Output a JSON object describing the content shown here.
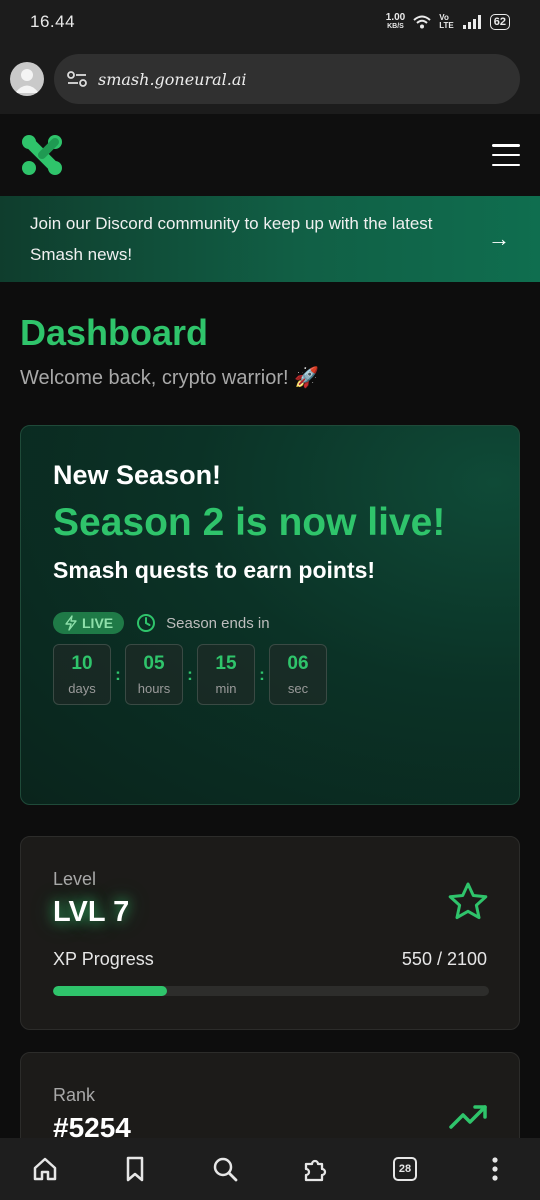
{
  "status_bar": {
    "time": "16.44",
    "net_speed": "1.00",
    "net_unit": "KB/S",
    "volte_top": "Vo",
    "volte_bottom": "LTE",
    "battery": "62"
  },
  "browser": {
    "url": "smash.goneural.ai",
    "icons": [
      "account-avatar-icon",
      "site-settings-icon"
    ]
  },
  "header": {
    "logo_icon": "smash-logo-icon",
    "menu_icon": "hamburger-menu-icon"
  },
  "banner": {
    "text": "Join our Discord community to keep up with the latest Smash news!",
    "arrow": "→"
  },
  "dashboard": {
    "title": "Dashboard",
    "subtitle": "Welcome back, crypto warrior! 🚀"
  },
  "season": {
    "kicker": "New Season!",
    "headline": "Season 2 is now live!",
    "subline": "Smash quests to earn points!",
    "badge": "LIVE",
    "ends_label": "Season ends in",
    "countdown": [
      {
        "value": "10",
        "unit": "days"
      },
      {
        "value": "05",
        "unit": "hours"
      },
      {
        "value": "15",
        "unit": "min"
      },
      {
        "value": "06",
        "unit": "sec"
      }
    ],
    "separator": ":"
  },
  "level": {
    "label": "Level",
    "value": "LVL 7",
    "xp_label": "XP Progress",
    "xp_value": "550 / 2100",
    "xp_current": 550,
    "xp_max": 2100
  },
  "rank": {
    "label": "Rank",
    "value": "#5254"
  },
  "bottom_nav": {
    "tab_count": "28",
    "items": [
      "home-icon",
      "bookmark-icon",
      "search-icon",
      "extensions-icon",
      "tabs-icon",
      "more-menu-icon"
    ]
  },
  "colors": {
    "accent": "#2fc46b",
    "background": "#0d0d0d",
    "card": "#1c1b19"
  }
}
